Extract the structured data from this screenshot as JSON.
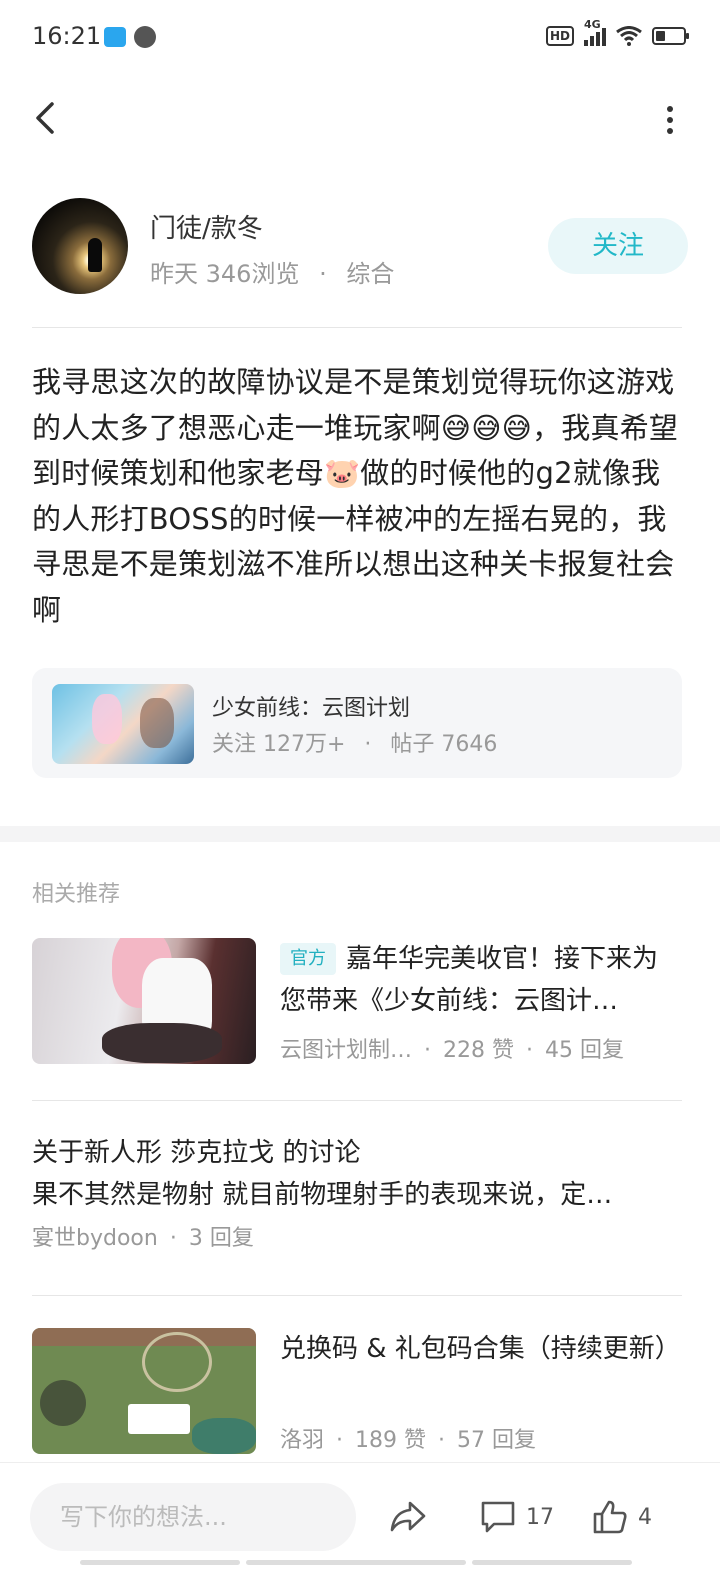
{
  "status_bar": {
    "time": "16:21",
    "hd": "HD",
    "network": "4G"
  },
  "author": {
    "name": "门徒/款冬",
    "date": "昨天",
    "views": "346浏览",
    "category": "综合",
    "follow_label": "关注"
  },
  "post": {
    "body_html": "我寻思这次的故障协议是不是策划觉得玩你这游戏的人太多了想恶心走一堆玩家啊😅😅😅，我真希望到时候策划和他家老母🐷做的时候他的g2就像我的人形打BOSS的时候一样被冲的左摇右晃的，我寻思是不是策划滋不准所以想出这种关卡报复社会啊"
  },
  "game": {
    "title": "少女前线：云图计划",
    "followers": "关注 127万+",
    "posts": "帖子 7646"
  },
  "recommend": {
    "heading": "相关推荐",
    "items": [
      {
        "badge": "官方",
        "title": "嘉年华完美收官！接下来为您带来《少女前线：云图计…",
        "author": "云图计划制…",
        "likes": "228 赞",
        "replies": "45 回复"
      },
      {
        "title": "关于新人形  莎克拉戈  的讨论",
        "excerpt": "果不其然是物射  就目前物理射手的表现来说，定…",
        "author": "宴世bydoon",
        "replies": "3 回复"
      },
      {
        "title": "兑换码  &  礼包码合集（持续更新）",
        "author": "洛羽",
        "likes": "189 赞",
        "replies": "57 回复"
      }
    ]
  },
  "bottom_bar": {
    "placeholder": "写下你的想法...",
    "comment_count": "17",
    "like_count": "4"
  }
}
